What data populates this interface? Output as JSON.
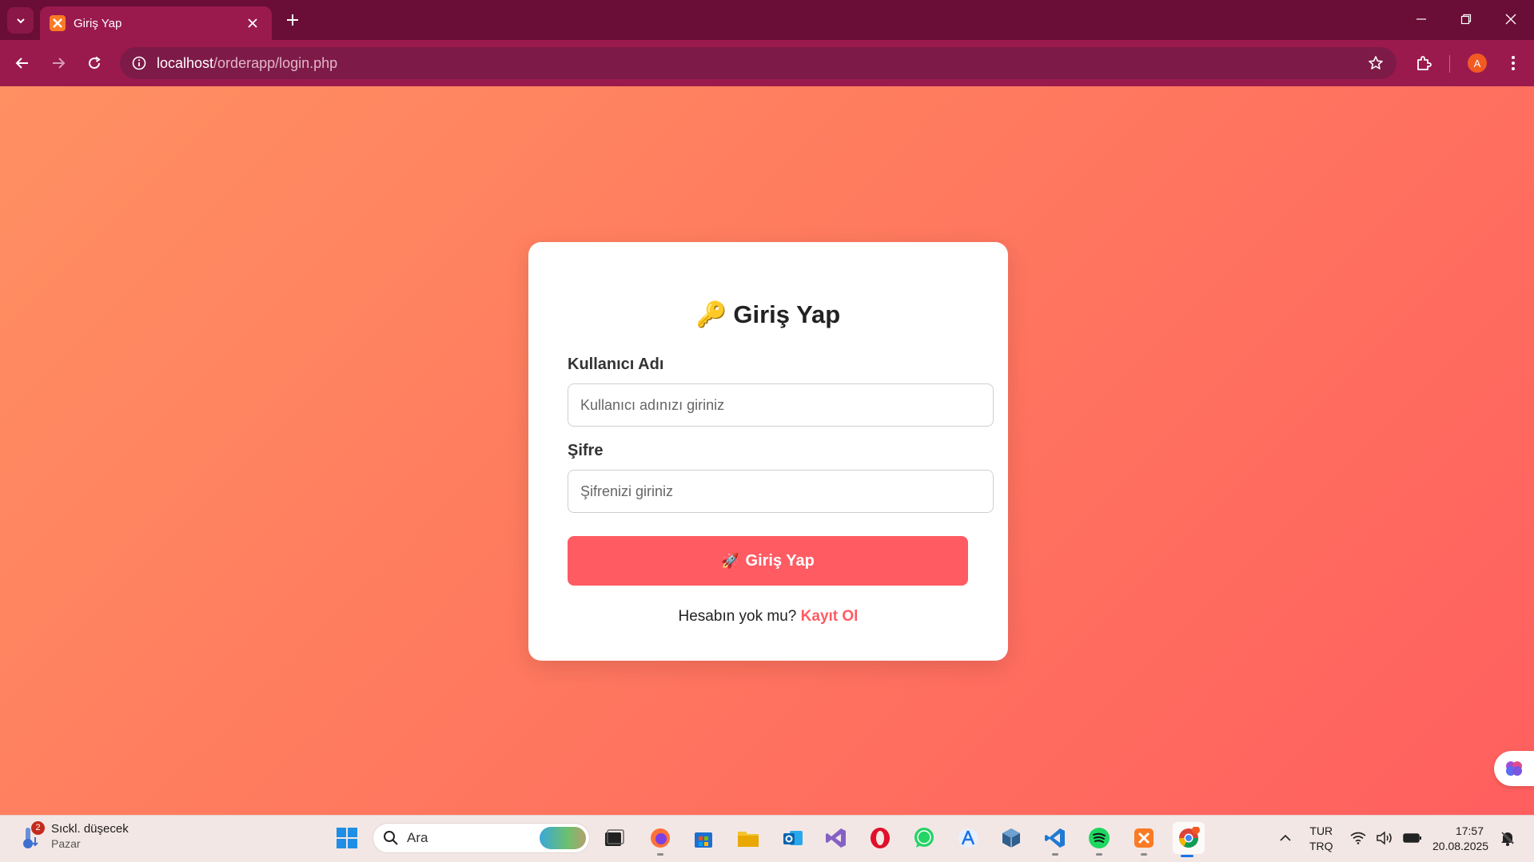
{
  "browser": {
    "tab_title": "Giriş Yap",
    "url_host": "localhost",
    "url_path": "/orderapp/login.php",
    "profile_initial": "A",
    "theme_color": "#9a1a4e"
  },
  "login": {
    "title": "Giriş Yap",
    "title_icon": "🔑",
    "username_label": "Kullanıcı Adı",
    "username_placeholder": "Kullanıcı adınızı giriniz",
    "username_value": "",
    "password_label": "Şifre",
    "password_placeholder": "Şifrenizi giriniz",
    "password_value": "",
    "submit_icon": "🚀",
    "submit_label": "Giriş Yap",
    "register_prompt": "Hesabın yok mu?",
    "register_link": "Kayıt Ol",
    "accent_color": "#ff5b63"
  },
  "taskbar": {
    "weather_badge": "2",
    "weather_line1": "Sıckl. düşecek",
    "weather_line2": "Pazar",
    "search_placeholder": "Ara",
    "apps": [
      "start-icon",
      "task-view-icon",
      "firefox-icon",
      "store-icon",
      "file-explorer-icon",
      "outlook-icon",
      "visual-studio-icon",
      "opera-icon",
      "whatsapp-icon",
      "app-icon",
      "virtualbox-icon",
      "vscode-icon",
      "spotify-icon",
      "xampp-icon",
      "chrome-icon"
    ],
    "lang_line1": "TUR",
    "lang_line2": "TRQ",
    "time": "17:57",
    "date": "20.08.2025"
  }
}
